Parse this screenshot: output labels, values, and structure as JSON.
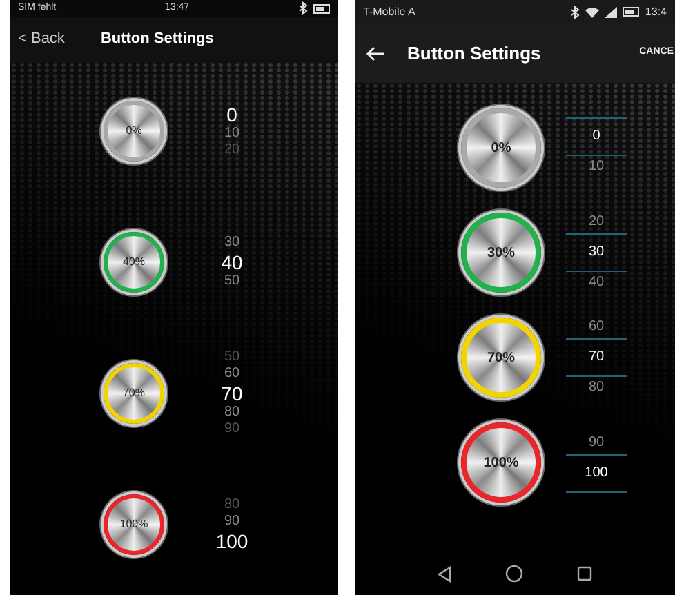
{
  "phones": [
    {
      "kind": "ios",
      "status": {
        "carrier": "SIM fehlt",
        "time": "13:47"
      },
      "nav": {
        "back": "< Back",
        "title": "Button Settings"
      },
      "rows": [
        {
          "label": "0%",
          "color": "#a9a9a9",
          "values": [
            {
              "text": "0",
              "selected": true
            },
            {
              "text": "10",
              "selected": false
            },
            {
              "text": "20",
              "selected": false
            }
          ]
        },
        {
          "label": "40%",
          "color": "#22b14c",
          "values": [
            {
              "text": "30",
              "selected": false
            },
            {
              "text": "40",
              "selected": true
            },
            {
              "text": "50",
              "selected": false
            }
          ]
        },
        {
          "label": "70%",
          "color": "#f2d500",
          "values": [
            {
              "text": "50",
              "selected": false
            },
            {
              "text": "60",
              "selected": false
            },
            {
              "text": "70",
              "selected": true
            },
            {
              "text": "80",
              "selected": false
            },
            {
              "text": "90",
              "selected": false
            }
          ]
        },
        {
          "label": "100%",
          "color": "#e8262b",
          "values": [
            {
              "text": "80",
              "selected": false
            },
            {
              "text": "90",
              "selected": false
            },
            {
              "text": "100",
              "selected": true
            }
          ]
        }
      ]
    },
    {
      "kind": "android",
      "status": {
        "carrier": "T-Mobile A",
        "time": "13:4"
      },
      "nav": {
        "title": "Button Settings",
        "action": "CANCE"
      },
      "rows": [
        {
          "label": "0%",
          "color": "#a9a9a9",
          "values": [
            {
              "text": "0",
              "selected": true
            },
            {
              "text": "10",
              "selected": false
            }
          ]
        },
        {
          "label": "30%",
          "color": "#22b14c",
          "values": [
            {
              "text": "20",
              "selected": false
            },
            {
              "text": "30",
              "selected": true
            },
            {
              "text": "40",
              "selected": false
            }
          ]
        },
        {
          "label": "70%",
          "color": "#f2d500",
          "values": [
            {
              "text": "60",
              "selected": false
            },
            {
              "text": "70",
              "selected": true
            },
            {
              "text": "80",
              "selected": false
            }
          ]
        },
        {
          "label": "100%",
          "color": "#e8262b",
          "values": [
            {
              "text": "90",
              "selected": false
            },
            {
              "text": "100",
              "selected": true
            }
          ]
        }
      ]
    }
  ]
}
